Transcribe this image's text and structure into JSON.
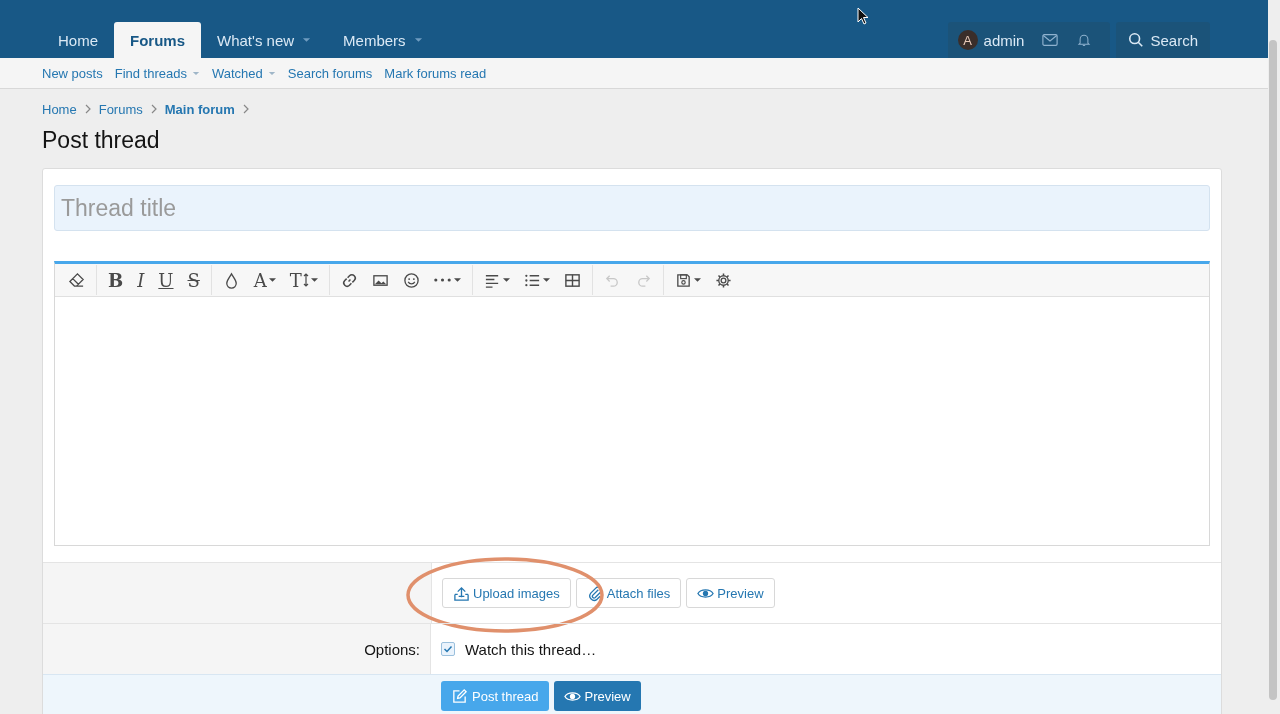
{
  "nav": {
    "tabs": [
      {
        "label": "Home",
        "selected": false,
        "dropdown": false
      },
      {
        "label": "Forums",
        "selected": true,
        "dropdown": false
      },
      {
        "label": "What's new",
        "selected": false,
        "dropdown": true
      },
      {
        "label": "Members",
        "selected": false,
        "dropdown": true
      }
    ],
    "account": {
      "avatar_letter": "A",
      "username": "admin"
    },
    "search_button": "Search"
  },
  "subnav": [
    {
      "label": "New posts",
      "dropdown": false
    },
    {
      "label": "Find threads",
      "dropdown": true
    },
    {
      "label": "Watched",
      "dropdown": true
    },
    {
      "label": "Search forums",
      "dropdown": false
    },
    {
      "label": "Mark forums read",
      "dropdown": false
    }
  ],
  "breadcrumbs": [
    {
      "label": "Home",
      "current": false
    },
    {
      "label": "Forums",
      "current": false
    },
    {
      "label": "Main forum",
      "current": true
    }
  ],
  "page_title": "Post thread",
  "title_field": {
    "placeholder": "Thread title"
  },
  "editor": {
    "toolbar": [
      [
        {
          "kind": "eraser",
          "dropdown": false,
          "disabled": false
        }
      ],
      [
        {
          "kind": "bold",
          "glyph": "B",
          "dropdown": false,
          "disabled": false
        },
        {
          "kind": "italic",
          "glyph": "I",
          "dropdown": false,
          "disabled": false
        },
        {
          "kind": "underline",
          "glyph": "U",
          "dropdown": false,
          "disabled": false
        },
        {
          "kind": "strike",
          "glyph": "S",
          "dropdown": false,
          "disabled": false
        }
      ],
      [
        {
          "kind": "color",
          "dropdown": false,
          "disabled": false
        },
        {
          "kind": "font",
          "glyph": "A",
          "dropdown": true,
          "disabled": false
        },
        {
          "kind": "size",
          "glyph": "T",
          "dropdown": true,
          "disabled": false
        }
      ],
      [
        {
          "kind": "link",
          "dropdown": false,
          "disabled": false
        },
        {
          "kind": "image",
          "dropdown": false,
          "disabled": false
        },
        {
          "kind": "smilie",
          "dropdown": false,
          "disabled": false
        },
        {
          "kind": "more",
          "dropdown": true,
          "disabled": false
        }
      ],
      [
        {
          "kind": "align",
          "dropdown": true,
          "disabled": false
        },
        {
          "kind": "list",
          "dropdown": true,
          "disabled": false
        },
        {
          "kind": "table",
          "dropdown": false,
          "disabled": false
        }
      ],
      [
        {
          "kind": "undo",
          "dropdown": false,
          "disabled": true
        },
        {
          "kind": "redo",
          "dropdown": false,
          "disabled": true
        }
      ],
      [
        {
          "kind": "drafts",
          "dropdown": true,
          "disabled": false
        },
        {
          "kind": "settings",
          "dropdown": false,
          "disabled": false
        }
      ]
    ]
  },
  "attachment_buttons": [
    {
      "kind": "upload",
      "label": "Upload images"
    },
    {
      "kind": "attach",
      "label": "Attach files"
    },
    {
      "kind": "preview",
      "label": "Preview"
    }
  ],
  "options": {
    "label": "Options:",
    "items": [
      {
        "label": "Watch this thread…",
        "checked": true
      }
    ]
  },
  "footer_buttons": [
    {
      "kind": "primary",
      "label": "Post thread"
    },
    {
      "kind": "secondary",
      "label": "Preview"
    }
  ]
}
